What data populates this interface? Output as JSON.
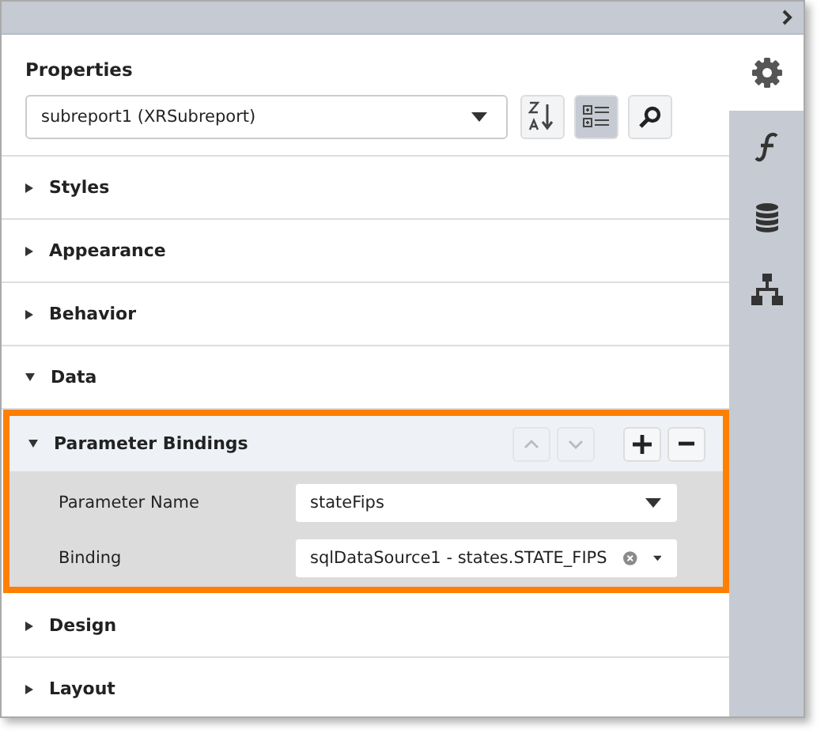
{
  "properties_panel": {
    "title": "Properties",
    "object_select": {
      "value": "subreport1 (XRSubreport)"
    },
    "toolbar": [
      {
        "kind": "sort",
        "selected": false
      },
      {
        "kind": "categories",
        "selected": true
      },
      {
        "kind": "search",
        "selected": false
      }
    ]
  },
  "side_tabs": [
    {
      "kind": "settings",
      "selected": true
    },
    {
      "kind": "function",
      "selected": false
    },
    {
      "kind": "database",
      "selected": false
    },
    {
      "kind": "structure",
      "selected": false
    }
  ],
  "sections": [
    {
      "label": "Styles",
      "expanded": false
    },
    {
      "label": "Appearance",
      "expanded": false
    },
    {
      "label": "Behavior",
      "expanded": false
    },
    {
      "label": "Data",
      "expanded": true
    },
    {
      "label": "Parameter Bindings",
      "expanded": true,
      "highlighted": true,
      "fields": [
        {
          "label": "Parameter Name",
          "value": "stateFips",
          "clearable": false
        },
        {
          "label": "Binding",
          "value": "sqlDataSource1 - states.STATE_FIPS",
          "clearable": true
        }
      ]
    },
    {
      "label": "Design",
      "expanded": false
    },
    {
      "label": "Layout",
      "expanded": false
    }
  ]
}
